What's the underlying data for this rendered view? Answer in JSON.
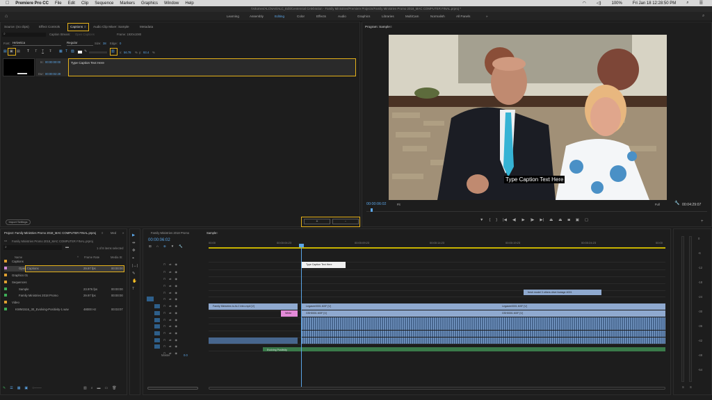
{
  "menubar": {
    "apple": "",
    "items": [
      "Premiere Pro CC",
      "File",
      "Edit",
      "Clip",
      "Sequence",
      "Markers",
      "Graphics",
      "Window",
      "Help"
    ],
    "clock": "Fri Jan 18  12:28:50 PM",
    "battery": "100%"
  },
  "titlebar": {
    "path": "/Volumes/ALCNAS/ALC_Edit/Centennial Celebration - Family Ministries/Premiere Projects/Family Ministries Promo 2018_MAC COMPUTER FINAL.prproj *"
  },
  "workspaces": {
    "items": [
      "Learning",
      "Assembly",
      "Editing",
      "Color",
      "Effects",
      "Audio",
      "Graphics",
      "Libraries",
      "MultiCam",
      "Normalish",
      "All Panels"
    ],
    "active": "Editing",
    "more": "»"
  },
  "source_panel": {
    "tabs": [
      "Source: (no clips)",
      "Effect Controls",
      "Captions",
      "Audio Clip Mixer: Sample",
      "Metadata"
    ],
    "active_tab": "Captions",
    "tab_menu": "≡",
    "caption_stream_label": "Caption Stream:",
    "caption_stream_value": "Open Captions",
    "frame_label": "Frame: 1920x1080",
    "font_label": "Font:",
    "font_value": "Helvetica",
    "style_value": "Regular",
    "size_label": "Size:",
    "size_value": "38",
    "edge_label": "Edge:",
    "edge_value": "0",
    "x_label": "x:",
    "x_value": "56.78",
    "pct1": "%",
    "y_label": "y:",
    "y_value": "93.4",
    "pct2": "%",
    "in_label": "In:",
    "in_value": "00:00:00:00",
    "dur_label": "Dur:",
    "dur_value": "00:00:02:29",
    "caption_text": "Type Caption Text Here",
    "import_settings": "Import Settings",
    "add_button": "+",
    "remove_button": "-"
  },
  "program_monitor": {
    "title": "Program: Sample",
    "tab_menu": "≡",
    "caption_overlay": "Type Caption Text Here",
    "timecode": "00:00:06:02",
    "fit": "Fit",
    "full": "Full",
    "duration": "00:04:29:07",
    "add": "+"
  },
  "project_panel": {
    "title": "Project: Family Ministries Promo 2018_MAC COMPUTER FINAL.prproj",
    "tab_menu": "≡",
    "tab2": "Med",
    "overflow": "»",
    "path": "Family Ministries Promo 2018_MAC COMPUTER FINAL.prproj",
    "count": "1 of 8 items selected",
    "columns": [
      "Name",
      "Frame Rate",
      "Media St"
    ],
    "rows": [
      {
        "name": "Captions",
        "rate": "",
        "start": "",
        "color": "#e0a030",
        "indent": 1
      },
      {
        "name": "Open Captions",
        "rate": "29.97 fps",
        "start": "00:00:00",
        "color": "#d08ad8",
        "indent": 3
      },
      {
        "name": "Graphics 01",
        "rate": "",
        "start": "",
        "color": "#e0a030",
        "indent": 1
      },
      {
        "name": "Sequences",
        "rate": "",
        "start": "",
        "color": "#e0a030",
        "indent": 1
      },
      {
        "name": "Sample",
        "rate": "23.976 fps",
        "start": "00:00:00",
        "color": "#3fae58",
        "indent": 3
      },
      {
        "name": "Family Ministries 2018 Promo",
        "rate": "29.97 fps",
        "start": "00:00:00",
        "color": "#3fae58",
        "indent": 3
      },
      {
        "name": "Video",
        "rate": "",
        "start": "",
        "color": "#e0a030",
        "indent": 1
      },
      {
        "name": "KWM1516_30_Evolving-Positivity-1.wav",
        "rate": "48000 Hz",
        "start": "00:03:07",
        "color": "#3fae58",
        "indent": 2
      }
    ]
  },
  "timeline": {
    "tab1": "Family Ministries 2018 Promo",
    "tab2": "Sample",
    "tab_menu": "≡",
    "timecode": "00:00:06:02",
    "ruler": [
      "00:00",
      "00:00:04:23",
      "00:00:09:23",
      "00:00:14:23",
      "00:00:19:23",
      "00:00:24:23",
      "00:00"
    ],
    "tracks": [
      "V8",
      "V7",
      "V6",
      "V5",
      "V4",
      "V3",
      "V2",
      "V1",
      "A1",
      "A2",
      "A3",
      "A4",
      "A5",
      "A6",
      "A7"
    ],
    "master_label": "Master",
    "master_value": "0.0",
    "clips": {
      "caption": "Type Caption Text Here",
      "v3": "fresh model 3 others drive footage 4001 ",
      "v2a": "Family Ministries to ALC intro.mp4 [V]",
      "v2b": "Legasee0001.MXF [V]",
      "v2c": "Legasee0001.MXF [V]",
      "v1a": "White",
      "v1b": "GSH0001.MXF [V]",
      "v1c": "GSH0001.MXF [V]",
      "a7": "Evolving Positivity"
    }
  },
  "tools": [
    "▶",
    "⇹",
    "✥",
    "⌖",
    "|↔|",
    "✎",
    "✋",
    "T"
  ],
  "meter_labels": [
    "0",
    "-6",
    "-12",
    "-18",
    "-24",
    "-30",
    "-36",
    "-42",
    "-48",
    "-54"
  ],
  "meter_solo": [
    "S",
    "S"
  ]
}
